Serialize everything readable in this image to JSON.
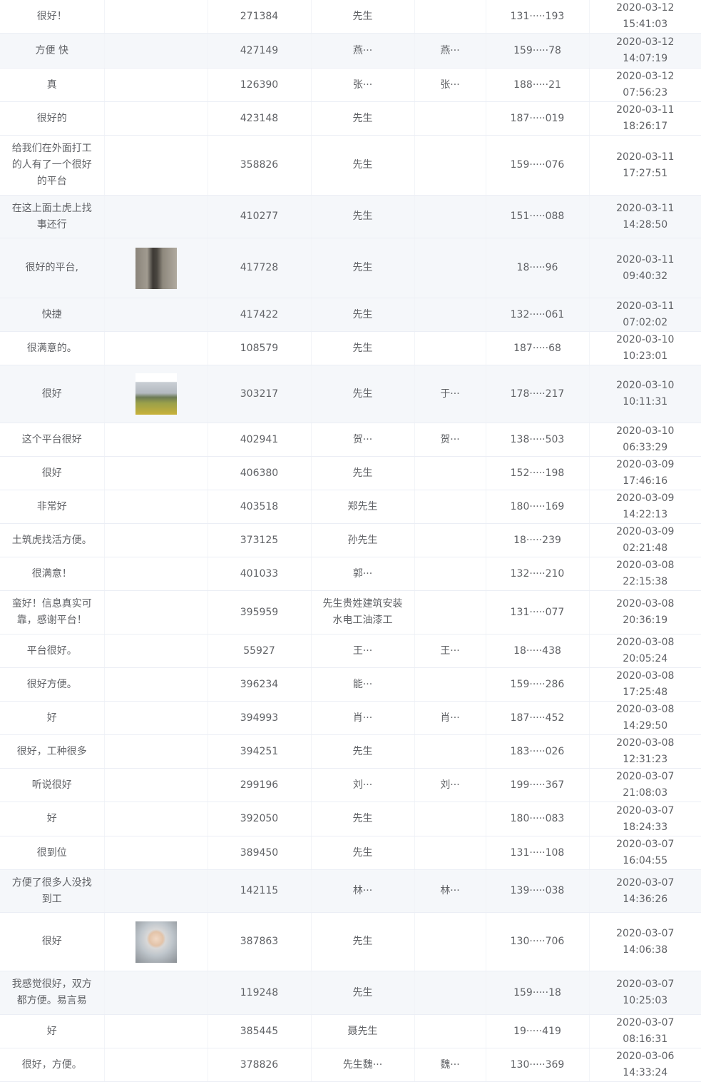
{
  "rows": [
    {
      "comment": "很好！",
      "image": "",
      "id": "271384",
      "contact": "先生",
      "name": "",
      "phone": "131·····193",
      "time": "2020-03-12 15:41:03",
      "h": 46,
      "alt": false
    },
    {
      "comment": "方便 快",
      "image": "",
      "id": "427149",
      "contact": "燕···",
      "name": "燕···",
      "phone": "159·····78",
      "time": "2020-03-12 14:07:19",
      "h": 49,
      "alt": true
    },
    {
      "comment": "真",
      "image": "",
      "id": "126390",
      "contact": "张···",
      "name": "张···",
      "phone": "188·····21",
      "time": "2020-03-12 07:56:23",
      "h": 47,
      "alt": false
    },
    {
      "comment": "很好的",
      "image": "",
      "id": "423148",
      "contact": "先生",
      "name": "",
      "phone": "187·····019",
      "time": "2020-03-11 18:26:17",
      "h": 46,
      "alt": false
    },
    {
      "comment": "给我们在外面打工的人有了一个很好的平台",
      "image": "",
      "id": "358826",
      "contact": "先生",
      "name": "",
      "phone": "159·····076",
      "time": "2020-03-11 17:27:51",
      "h": 84,
      "alt": false
    },
    {
      "comment": "在这上面土虎上找事还行",
      "image": "",
      "id": "410277",
      "contact": "先生",
      "name": "",
      "phone": "151·····088",
      "time": "2020-03-11 14:28:50",
      "h": 60,
      "alt": true
    },
    {
      "comment": "很好的平台,",
      "image": "road",
      "id": "417728",
      "contact": "先生",
      "name": "",
      "phone": "18·····96",
      "time": "2020-03-11 09:40:32",
      "h": 84,
      "alt": true
    },
    {
      "comment": "快捷",
      "image": "",
      "id": "417422",
      "contact": "先生",
      "name": "",
      "phone": "132·····061",
      "time": "2020-03-11 07:02:02",
      "h": 44,
      "alt": true
    },
    {
      "comment": "很满意的。",
      "image": "",
      "id": "108579",
      "contact": "先生",
      "name": "",
      "phone": "187·····68",
      "time": "2020-03-10 10:23:01",
      "h": 47,
      "alt": false
    },
    {
      "comment": "很好",
      "image": "field",
      "id": "303217",
      "contact": "先生",
      "name": "于···",
      "phone": "178·····217",
      "time": "2020-03-10 10:11:31",
      "h": 81,
      "alt": true
    },
    {
      "comment": "这个平台很好",
      "image": "",
      "id": "402941",
      "contact": "贺···",
      "name": "贺···",
      "phone": "138·····503",
      "time": "2020-03-10 06:33:29",
      "h": 46,
      "alt": false
    },
    {
      "comment": "很好",
      "image": "",
      "id": "406380",
      "contact": "先生",
      "name": "",
      "phone": "152·····198",
      "time": "2020-03-09 17:46:16",
      "h": 47,
      "alt": false
    },
    {
      "comment": "非常好",
      "image": "",
      "id": "403518",
      "contact": "郑先生",
      "name": "",
      "phone": "180·····169",
      "time": "2020-03-09 14:22:13",
      "h": 42,
      "alt": false
    },
    {
      "comment": "土筑虎找活方便。",
      "image": "",
      "id": "373125",
      "contact": "孙先生",
      "name": "",
      "phone": "18·····239",
      "time": "2020-03-09 02:21:48",
      "h": 47,
      "alt": false
    },
    {
      "comment": "很满意！",
      "image": "",
      "id": "401033",
      "contact": "郭···",
      "name": "",
      "phone": "132·····210",
      "time": "2020-03-08 22:15:38",
      "h": 47,
      "alt": false
    },
    {
      "comment": "蛮好！信息真实可靠，感谢平台！",
      "image": "",
      "id": "395959",
      "contact": "先生贵姓建筑安装水电工油漆工",
      "name": "",
      "phone": "131·····077",
      "time": "2020-03-08 20:36:19",
      "h": 61,
      "alt": false
    },
    {
      "comment": "平台很好。",
      "image": "",
      "id": "55927",
      "contact": "王···",
      "name": "王···",
      "phone": "18·····438",
      "time": "2020-03-08 20:05:24",
      "h": 46,
      "alt": false
    },
    {
      "comment": "很好方便。",
      "image": "",
      "id": "396234",
      "contact": "能···",
      "name": "",
      "phone": "159·····286",
      "time": "2020-03-08 17:25:48",
      "h": 47,
      "alt": false
    },
    {
      "comment": "好",
      "image": "",
      "id": "394993",
      "contact": "肖···",
      "name": "肖···",
      "phone": "187·····452",
      "time": "2020-03-08 14:29:50",
      "h": 46,
      "alt": false
    },
    {
      "comment": "很好，工种很多",
      "image": "",
      "id": "394251",
      "contact": "先生",
      "name": "",
      "phone": "183·····026",
      "time": "2020-03-08 12:31:23",
      "h": 46,
      "alt": false
    },
    {
      "comment": "听说很好",
      "image": "",
      "id": "299196",
      "contact": "刘···",
      "name": "刘···",
      "phone": "199·····367",
      "time": "2020-03-07 21:08:03",
      "h": 46,
      "alt": false
    },
    {
      "comment": "好",
      "image": "",
      "id": "392050",
      "contact": "先生",
      "name": "",
      "phone": "180·····083",
      "time": "2020-03-07 18:24:33",
      "h": 48,
      "alt": false
    },
    {
      "comment": "很到位",
      "image": "",
      "id": "389450",
      "contact": "先生",
      "name": "",
      "phone": "131·····108",
      "time": "2020-03-07 16:04:55",
      "h": 46,
      "alt": false
    },
    {
      "comment": "方便了很多人没找到工",
      "image": "",
      "id": "142115",
      "contact": "林···",
      "name": "林···",
      "phone": "139·····038",
      "time": "2020-03-07 14:36:26",
      "h": 60,
      "alt": true
    },
    {
      "comment": "很好",
      "image": "face",
      "id": "387863",
      "contact": "先生",
      "name": "",
      "phone": "130·····706",
      "time": "2020-03-07 14:06:38",
      "h": 82,
      "alt": false
    },
    {
      "comment": "我感觉很好，双方都方便。易言易",
      "image": "",
      "id": "119248",
      "contact": "先生",
      "name": "",
      "phone": "159·····18",
      "time": "2020-03-07 10:25:03",
      "h": 61,
      "alt": true
    },
    {
      "comment": "好",
      "image": "",
      "id": "385445",
      "contact": "聂先生",
      "name": "",
      "phone": "19·····419",
      "time": "2020-03-07 08:16:31",
      "h": 44,
      "alt": false
    },
    {
      "comment": "很好，方便。",
      "image": "",
      "id": "378826",
      "contact": "先生魏···",
      "name": "魏···",
      "phone": "130·····369",
      "time": "2020-03-06 14:33:24",
      "h": 47,
      "alt": false
    }
  ]
}
